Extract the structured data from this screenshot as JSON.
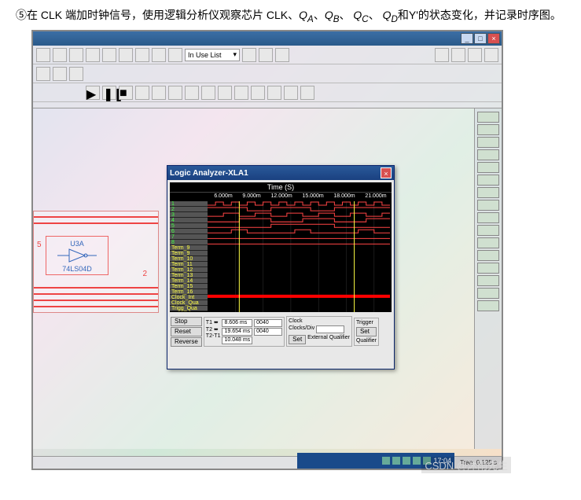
{
  "instruction": {
    "bullet": "⑤",
    "text_pre": "在 CLK 端加时钟信号，使用逻辑分析仪观察芯片 CLK、",
    "qa": "Q",
    "qa_sub": "A",
    "qb": "Q",
    "qb_sub": "B",
    "qc": "Q",
    "qc_sub": "C",
    "qd": "Q",
    "qd_sub": "D",
    "text_post": "和Y'的状态变化，并记录时序图。"
  },
  "app": {
    "toolbar_dropdown": "In Use List",
    "chip": {
      "ref": "U3A",
      "part": "74LS04D",
      "pin": "2",
      "bus_label": "5"
    },
    "status": "Tran: 0.125 s"
  },
  "analyzer": {
    "title": "Logic Analyzer-XLA1",
    "time_header": "Time (S)",
    "time_ticks": [
      "6.000m",
      "9.000m",
      "12.000m",
      "15.000m",
      "18.000m",
      "21.000m"
    ],
    "channels_num": [
      "1",
      "2",
      "3",
      "4",
      "5",
      "6",
      "7",
      "8"
    ],
    "channels_term": [
      "Term_9",
      "Term_9",
      "Term_10",
      "Term_11",
      "Term_12",
      "Term_13",
      "Term_14",
      "Term_15",
      "Term_16"
    ],
    "channels_clock": [
      "Clock_Int",
      "Clock_Qua",
      "Trigg_Qua"
    ],
    "controls": {
      "stop": "Stop",
      "reset": "Reset",
      "reverse": "Reverse",
      "t1_label": "T1",
      "t2_label": "T2",
      "t21_label": "T2-T1",
      "t1_val": "8.606 ms",
      "t2_val": "19.654 ms",
      "t21_val": "10.048 ms",
      "zero1": "0040",
      "zero2": "0040",
      "clock_label": "Clock",
      "clocks_div": "Clocks/Div",
      "set": "Set",
      "external": "External",
      "qualifier": "Qualifier",
      "trigger": "Trigger",
      "qualifier2": "Qualifier"
    }
  },
  "taskbar": {
    "time": "17:04"
  },
  "watermark": "CSDN @沐雨先生",
  "chart_data": {
    "type": "waveform",
    "title": "Logic Analyzer-XLA1",
    "xlabel": "Time (S)",
    "x_ticks": [
      0.006,
      0.009,
      0.012,
      0.015,
      0.018,
      0.021
    ],
    "channels": [
      {
        "name": "1 (CLK)",
        "pattern": "square wave ~1.5ms period"
      },
      {
        "name": "2",
        "pattern": "high with transitions"
      },
      {
        "name": "3",
        "pattern": "divided clock /2"
      },
      {
        "name": "4",
        "pattern": "divided clock /4"
      },
      {
        "name": "5",
        "pattern": "divided clock /8"
      },
      {
        "name": "6",
        "pattern": "pulse train"
      },
      {
        "name": "7",
        "pattern": "low constant"
      },
      {
        "name": "8",
        "pattern": "low constant"
      }
    ],
    "cursors": {
      "T1": 0.008606,
      "T2": 0.019654,
      "delta": 0.010048
    }
  }
}
